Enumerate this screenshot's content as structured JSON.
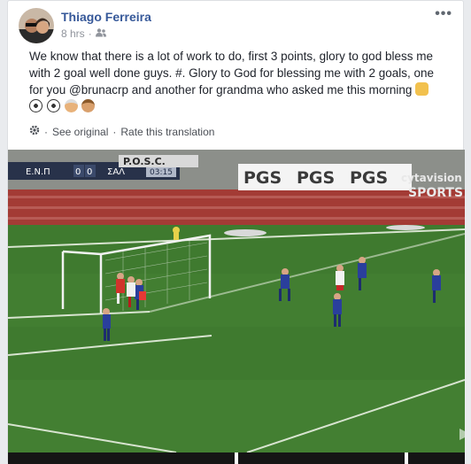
{
  "post": {
    "author": "Thiago Ferreira",
    "time": "8 hrs",
    "separator": "·",
    "more_label": "•••",
    "text_main": "We know that there is a lot of work to do, first 3 points, glory to god bless me with 2 goal well done guys. #. Glory to God for blessing me with 2 goals, one for you @brunacrp and another for grandma who asked me this morning",
    "emojis": [
      "praying-hands-emoji",
      "soccer-ball-emoji",
      "soccer-ball-emoji",
      "old-man-emoji",
      "old-woman-emoji"
    ],
    "see_original": "See original",
    "dot": "·",
    "rate_translation": "Rate this translation"
  },
  "video": {
    "scoreboard": {
      "home": "Ε.Ν.Π",
      "home_score": "0",
      "away_score": "0",
      "away": "ΣΑΛ",
      "clock": "03:15"
    },
    "stadium_sign": "P.O.S.C.",
    "board_sign": "PGS",
    "broadcaster_line1": "cytavision",
    "broadcaster_line2": "SPORTS"
  },
  "colors": {
    "link": "#365899",
    "text": "#1d2129",
    "meta": "#90949c",
    "pitch": "#3f7a2f"
  }
}
